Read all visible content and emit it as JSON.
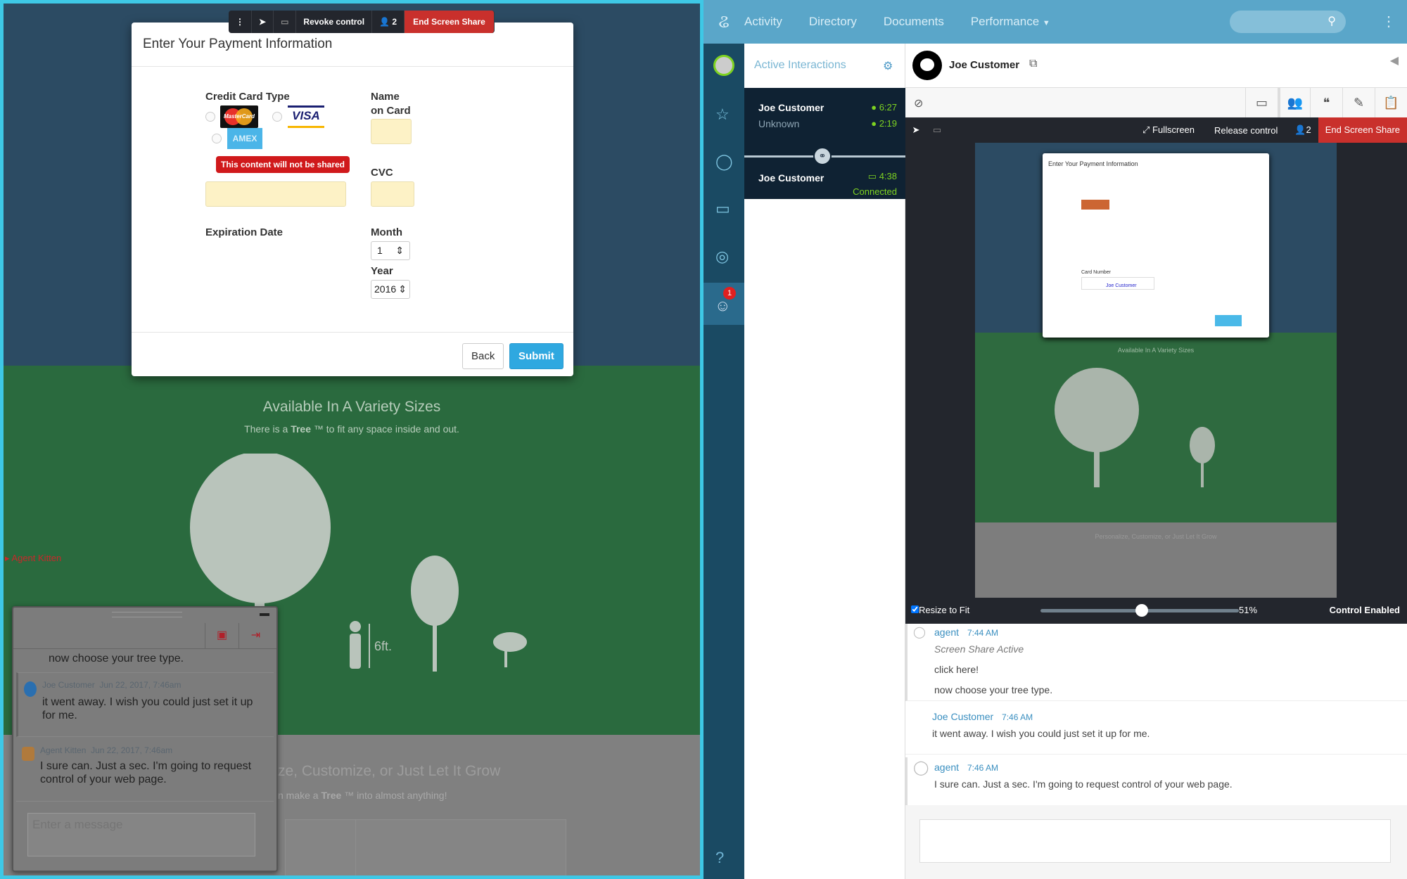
{
  "left": {
    "share_toolbar": {
      "revoke_label": "Revoke control",
      "participants": "2",
      "end_label": "End Screen Share"
    },
    "modal": {
      "title": "Enter Your Payment Information",
      "card_type_label": "Credit Card Type",
      "card_brands": [
        "MasterCard",
        "VISA",
        "AMEX"
      ],
      "name_label_1": "Name",
      "name_label_2": "on Card",
      "tooltip": "This content will not be shared",
      "cvc_label": "CVC",
      "exp_label": "Expiration Date",
      "month_label": "Month",
      "month_value": "1",
      "year_label": "Year",
      "year_value": "2016",
      "back_label": "Back",
      "submit_label": "Submit"
    },
    "page": {
      "heading": "Available In A Variety Sizes",
      "subtext_pre": "There is a ",
      "subtext_bold": "Tree",
      "subtext_post": " ™ to fit any space inside and out.",
      "height_label": "6ft.",
      "heading2": "ze, Customize, or Just Let It Grow",
      "subtext2_pre": "n make a ",
      "subtext2_bold": "Tree",
      "subtext2_post": " ™ into almost anything!",
      "cursor_label": "Agent Kitten"
    },
    "chat": {
      "prev_msg": "now choose your tree type.",
      "messages": [
        {
          "author": "Joe Customer",
          "time": "Jun 22, 2017, 7:46am",
          "text": "it went away. I wish you could just set it up for me."
        },
        {
          "author": "Agent Kitten",
          "time": "Jun 22, 2017, 7:46am",
          "text": "I sure can. Just a sec. I'm going to request control of your web page."
        }
      ],
      "placeholder": "Enter a message"
    }
  },
  "right": {
    "nav": {
      "items": [
        "Activity",
        "Directory",
        "Documents",
        "Performance"
      ],
      "search_placeholder": ""
    },
    "interactions": {
      "title": "Active Interactions",
      "items": [
        {
          "name": "Joe Customer",
          "sub": "Unknown",
          "time1": "6:27",
          "time2": "2:19"
        },
        {
          "name": "Joe Customer",
          "time1": "4:38",
          "status": "Connected"
        }
      ]
    },
    "notification_count": "1",
    "conversation": {
      "customer": "Joe Customer"
    },
    "share_bar": {
      "fullscreen": "Fullscreen",
      "release": "Release control",
      "participants": "2",
      "end": "End Screen Share"
    },
    "preview": {
      "title": "Enter Your Payment Information",
      "card_number_label": "Card Number",
      "cursor_label": "Joe Customer",
      "heading": "Available In A Variety Sizes",
      "heading2": "Personalize, Customize, or Just Let It Grow"
    },
    "bottom_bar": {
      "resize_label": "Resize to Fit",
      "resize_checked": true,
      "zoom_percent": 51,
      "zoom_label": "51%",
      "control_status": "Control Enabled"
    },
    "messages": [
      {
        "author": "agent",
        "time": "7:44 AM",
        "lines": [
          "Screen Share Active",
          "click here!",
          "now choose your tree type."
        ]
      },
      {
        "author": "Joe Customer",
        "time": "7:46 AM",
        "lines": [
          "it went away. I wish you could just set it up for me."
        ]
      },
      {
        "author": "agent",
        "time": "7:46 AM",
        "lines": [
          "I sure can. Just a sec. I'm going to request control of your web page."
        ]
      }
    ]
  },
  "colors": {
    "accent": "#5aa6c9",
    "danger": "#c9302c",
    "submit": "#2fa8e0",
    "green_status": "#7ed321",
    "border": "#3ec8e6"
  }
}
